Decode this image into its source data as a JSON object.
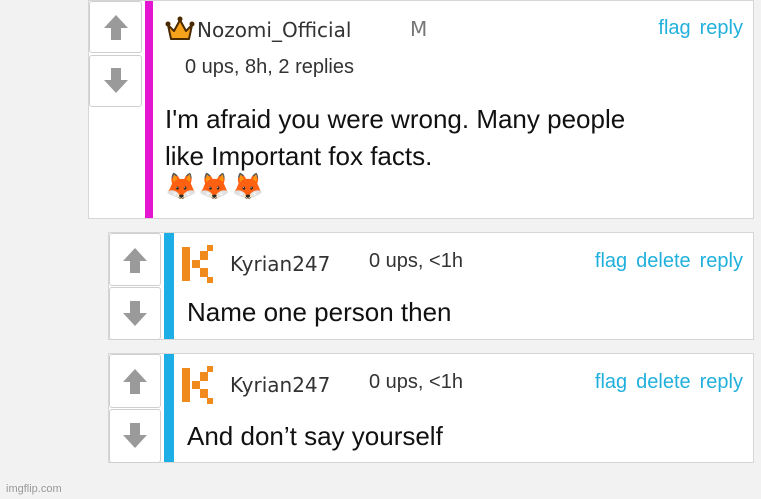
{
  "comments": [
    {
      "username": "Nozomi_Official",
      "mod_badge": "M",
      "meta": "0 ups, 8h, 2 replies",
      "actions": {
        "flag": "flag",
        "reply": "reply"
      },
      "text_line1": "I'm afraid you were wrong. Many people",
      "text_line2": "like Important fox facts.",
      "emoji": "🦊🦊🦊",
      "bar_color": "#e516d1",
      "avatar_icon": "crown-icon"
    },
    {
      "username": "Kyrian247",
      "meta": "0 ups, <1h",
      "actions": {
        "flag": "flag",
        "delete": "delete",
        "reply": "reply"
      },
      "text": "Name one person then",
      "bar_color": "#1eaee6",
      "avatar_icon": "k-logo-icon"
    },
    {
      "username": "Kyrian247",
      "meta": "0 ups, <1h",
      "actions": {
        "flag": "flag",
        "delete": "delete",
        "reply": "reply"
      },
      "text": "And don’t say yourself",
      "bar_color": "#1eaee6",
      "avatar_icon": "k-logo-icon"
    }
  ],
  "watermark": "imgflip.com",
  "colors": {
    "link": "#21b0dc",
    "arrow": "#9a9a9a",
    "k_logo": "#f08a1c"
  }
}
